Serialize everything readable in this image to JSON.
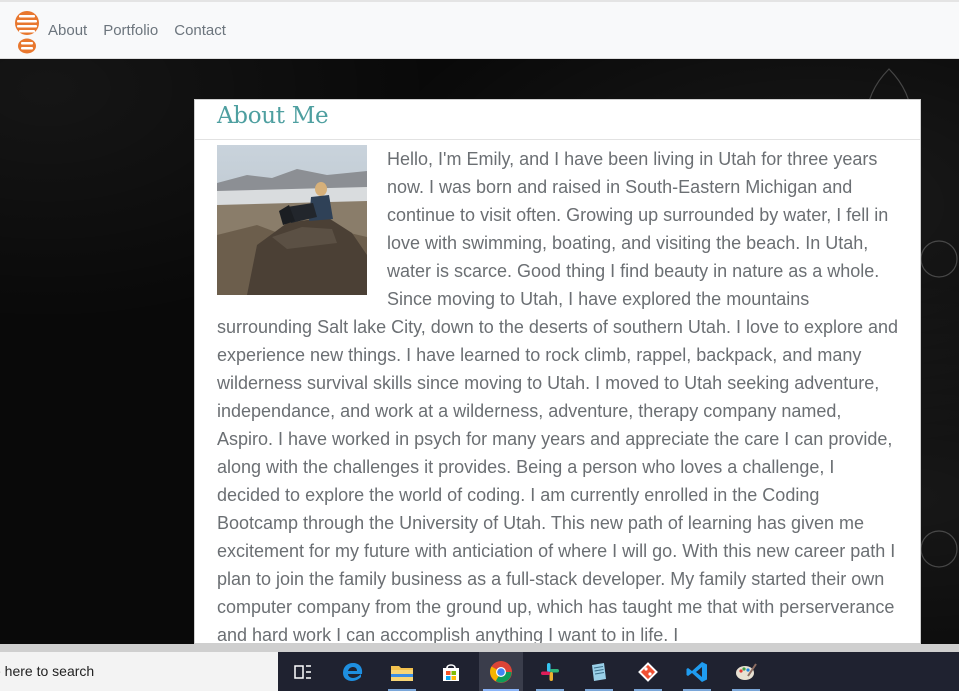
{
  "nav": {
    "links": [
      "About",
      "Portfolio",
      "Contact"
    ]
  },
  "card": {
    "title": "About Me",
    "photo_alt": "Emily sitting on rocks above a desert valley",
    "bio": "Hello, I'm Emily, and I have been living in Utah for three years now. I was born and raised in South-Eastern Michigan and continue to visit often. Growing up surrounded by water, I fell in love with swimming, boating, and visiting the beach. In Utah, water is scarce. Good thing I find beauty in nature as a whole. Since moving to Utah, I have explored the mountains surrounding Salt lake City, down to the deserts of southern Utah. I love to explore and experience new things. I have learned to rock climb, rappel, backpack, and many wilderness survival skills since moving to Utah. I moved to Utah seeking adventure, independance, and work at a wilderness, adventure, therapy company named, Aspiro. I have worked in psych for many years and appreciate the care I can provide, along with the challenges it provides. Being a person who loves a challenge, I decided to explore the world of coding. I am currently enrolled in the Coding Bootcamp through the University of Utah. This new path of learning has given me excitement for my future with anticiation of where I will go. With this new career path I plan to join the family business as a full-stack developer. My family started their own computer company from the ground up, which has taught me that with perserverance and hard work I can accomplish anything I want to in life. I"
  },
  "taskbar": {
    "search_text": "e here to search",
    "icons": [
      "task-view-icon",
      "edge-icon",
      "file-explorer-icon",
      "store-icon",
      "chrome-icon",
      "slack-icon",
      "notepad-icon",
      "git-icon",
      "vscode-icon",
      "paint-icon"
    ]
  },
  "colors": {
    "title": "#4e9fa0",
    "body_text": "#6b6f73",
    "logo": "#e8772e"
  }
}
